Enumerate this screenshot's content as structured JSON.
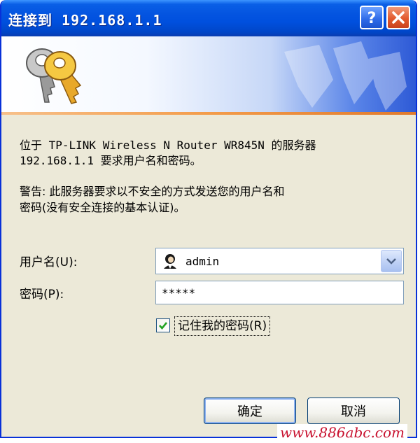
{
  "window": {
    "title": "连接到 192.168.1.1"
  },
  "message": {
    "line1": "位于 TP-LINK Wireless N Router WR845N 的服务器",
    "line2": "192.168.1.1 要求用户名和密码。",
    "warning_line1": "警告: 此服务器要求以不安全的方式发送您的用户名和",
    "warning_line2": "密码(没有安全连接的基本认证)。"
  },
  "form": {
    "username_label": "用户名(U):",
    "username_value": "admin",
    "password_label": "密码(P):",
    "password_value": "*****",
    "remember_label": "记住我的密码(R)",
    "remember_checked": true
  },
  "buttons": {
    "ok": "确定",
    "cancel": "取消"
  },
  "watermark": "www.886abc.com",
  "colors": {
    "titlebar": "#0454e0",
    "dialog_bg": "#ece9d8",
    "accent_line": "#f39c4a",
    "watermark": "#c8102e"
  },
  "icons": [
    "help-icon",
    "close-icon",
    "keys-icon",
    "user-icon",
    "dropdown-arrow-icon",
    "checkmark-icon"
  ]
}
